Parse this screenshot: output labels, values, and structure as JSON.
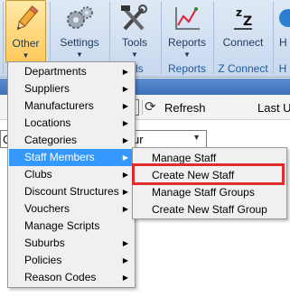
{
  "ribbon": {
    "buttons": [
      {
        "label": "Other",
        "icon": "pencil-icon"
      },
      {
        "label": "Settings",
        "icon": "gears-icon"
      },
      {
        "label": "Tools",
        "icon": "tools-icon"
      },
      {
        "label": "Reports",
        "icon": "chart-icon"
      },
      {
        "label": "Connect",
        "icon": "sleep-z-icon"
      },
      {
        "label": "H",
        "icon": "help-icon"
      }
    ],
    "groups": {
      "tools": "ols",
      "reports": "Reports",
      "z_connect": "Z Connect",
      "h": "H"
    }
  },
  "toolbar": {
    "refresh_label": "Refresh",
    "last_label": "Last U"
  },
  "combo": {
    "left_text": "G",
    "value": "ur"
  },
  "menu": {
    "items": [
      {
        "label": "Departments",
        "has_submenu": true
      },
      {
        "label": "Suppliers",
        "has_submenu": true
      },
      {
        "label": "Manufacturers",
        "has_submenu": true
      },
      {
        "label": "Locations",
        "has_submenu": true
      },
      {
        "label": "Categories",
        "has_submenu": true
      },
      {
        "label": "Staff Members",
        "has_submenu": true,
        "highlighted": true
      },
      {
        "label": "Clubs",
        "has_submenu": true
      },
      {
        "label": "Discount Structures",
        "has_submenu": true
      },
      {
        "label": "Vouchers",
        "has_submenu": true
      },
      {
        "label": "Manage Scripts",
        "has_submenu": false
      },
      {
        "label": "Suburbs",
        "has_submenu": true
      },
      {
        "label": "Policies",
        "has_submenu": true
      },
      {
        "label": "Reason Codes",
        "has_submenu": true
      }
    ]
  },
  "submenu": {
    "items": [
      {
        "label": "Manage Staff"
      },
      {
        "label": "Create New Staff",
        "outlined": true
      },
      {
        "label": "Manage Staff Groups"
      },
      {
        "label": "Create New Staff Group"
      }
    ]
  },
  "colors": {
    "highlight": "#3399ff",
    "outline": "#e22c2c",
    "active_button": "#ffc95a"
  }
}
